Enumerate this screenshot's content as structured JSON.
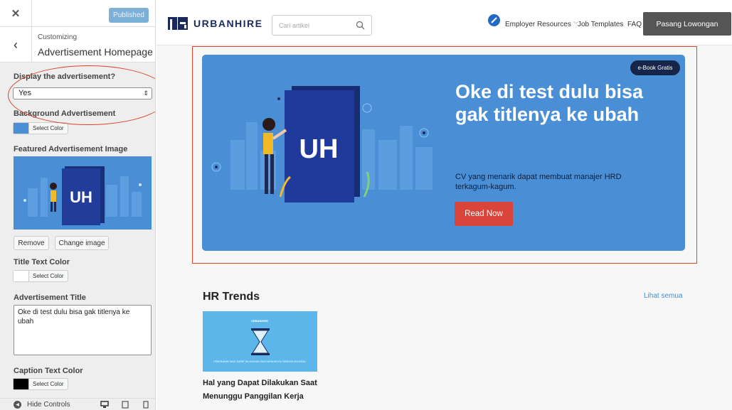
{
  "customizer": {
    "close_icon": "close-icon",
    "publish_button": "Published",
    "breadcrumb": "Customizing",
    "section_title": "Advertisement Homepage",
    "display": {
      "label": "Display the advertisement?",
      "value": "Yes"
    },
    "background": {
      "label": "Background Advertisement",
      "button": "Select Color",
      "color": "#4a8fd6"
    },
    "image": {
      "label": "Featured Advertisement Image",
      "remove": "Remove",
      "change": "Change image"
    },
    "title_color": {
      "label": "Title Text Color",
      "button": "Select Color",
      "color": "#ffffff"
    },
    "ad_title": {
      "label": "Advertisement Title",
      "value": "Oke di test dulu bisa gak titlenya ke ubah"
    },
    "caption_color": {
      "label": "Caption Text Color",
      "button": "Select Color",
      "color": "#000000"
    },
    "footer": {
      "hide_controls": "Hide Controls",
      "icons": [
        "desktop-icon",
        "tablet-icon",
        "mobile-icon"
      ]
    }
  },
  "site": {
    "logo_text": "URBANHIRE",
    "search": {
      "placeholder": "Cari artikel"
    },
    "nav": {
      "employer": "Employer Resources",
      "templates": "Job Templates",
      "faq": "FAQ",
      "cta": "Pasang Lowongan"
    },
    "banner": {
      "badge": "e-Book Gratis",
      "title": "Oke di test dulu bisa gak titlenya ke ubah",
      "caption": "CV yang menarik dapat membuat manajer HRD terkagum-kagum.",
      "button": "Read Now",
      "color": "#4a8fd6"
    },
    "trends": {
      "heading": "HR Trends",
      "see_all": "Lihat semua",
      "card": {
        "thumb_brand": "URBANHIRE",
        "thumb_caption": "PEKERJAAN YANG DAPAT DILAKUKAN SAAT MENUNGGU PANGGILAN KERJA",
        "title": "Hal yang Dapat Dilakukan Saat Menunggu Panggilan Kerja"
      }
    }
  },
  "colors": {
    "accent": "#e0452b",
    "brand_navy": "#1b2a5c",
    "cta_red": "#d9443b"
  }
}
